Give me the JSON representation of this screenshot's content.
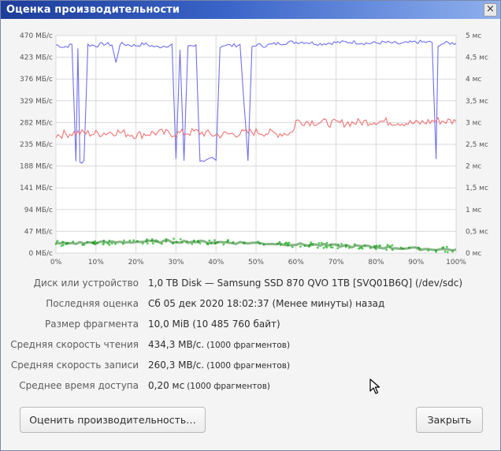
{
  "window": {
    "title": "Оценка производительности",
    "close_icon": "×"
  },
  "chart_data": {
    "type": "line",
    "x_ticks": [
      "0%",
      "10%",
      "20%",
      "30%",
      "40%",
      "50%",
      "60%",
      "70%",
      "80%",
      "90%",
      "100%"
    ],
    "y_left_ticks": [
      "0 МБ/с",
      "47 МБ/с",
      "94 МБ/с",
      "141 МБ/с",
      "188 МБ/с",
      "235 МБ/с",
      "282 МБ/с",
      "329 МБ/с",
      "376 МБ/с",
      "423 МБ/с",
      "470 МБ/с"
    ],
    "y_right_ticks": [
      "0 мс",
      "0,5 мс",
      "1 мс",
      "1,5 мс",
      "2 мс",
      "2,5 мс",
      "3 мс",
      "3,5 мс",
      "4 мс",
      "4,5 мс",
      "5 мс"
    ],
    "ylim_left": [
      0,
      470
    ],
    "ylim_right": [
      0,
      5
    ],
    "xlim": [
      0,
      100
    ],
    "grid": true,
    "colors": {
      "read": "#6f6ff0",
      "write": "#f07272",
      "access": "#22b822",
      "grid": "#d8d8d8"
    },
    "series": [
      {
        "key": "read",
        "axis": "left",
        "x": [
          0,
          2,
          4,
          5,
          5.5,
          6,
          7,
          8,
          10,
          12,
          14,
          15,
          16,
          18,
          20,
          22,
          25,
          29,
          30,
          31,
          32,
          33,
          34,
          35,
          36,
          37,
          38,
          39,
          40,
          41,
          42,
          44,
          46,
          48,
          49,
          50,
          52,
          55,
          58,
          62,
          66,
          70,
          74,
          78,
          82,
          86,
          90,
          94,
          95,
          95.5,
          96,
          98,
          100
        ],
        "y": [
          450,
          445,
          450,
          200,
          440,
          195,
          200,
          450,
          448,
          452,
          450,
          410,
          452,
          450,
          448,
          452,
          445,
          450,
          200,
          440,
          200,
          448,
          450,
          448,
          200,
          195,
          200,
          205,
          200,
          445,
          450,
          448,
          450,
          200,
          445,
          450,
          448,
          452,
          455,
          456,
          452,
          455,
          456,
          453,
          455,
          452,
          456,
          455,
          200,
          445,
          452,
          454,
          453
        ]
      },
      {
        "key": "write",
        "axis": "left",
        "x": [
          0,
          5,
          10,
          15,
          20,
          25,
          30,
          35,
          40,
          45,
          50,
          55,
          59,
          60,
          65,
          70,
          75,
          80,
          85,
          90,
          95,
          100
        ],
        "y": [
          255,
          260,
          258,
          262,
          255,
          260,
          258,
          262,
          255,
          258,
          262,
          258,
          260,
          285,
          283,
          280,
          282,
          285,
          283,
          280,
          286,
          284
        ]
      },
      {
        "key": "access",
        "axis": "right",
        "x": [
          0,
          10,
          20,
          30,
          40,
          50,
          60,
          70,
          80,
          90,
          100
        ],
        "y": [
          0.22,
          0.24,
          0.26,
          0.27,
          0.25,
          0.23,
          0.2,
          0.17,
          0.14,
          0.1,
          0.08
        ]
      }
    ]
  },
  "info": [
    {
      "label": "Диск или устройство",
      "value": "1,0 TB Disk — Samsung SSD 870 QVO 1TB [SVQ01B6Q] (/dev/sdc)",
      "note": ""
    },
    {
      "label": "Последняя оценка",
      "value": "Сб 05 дек 2020 18:02:37 (Менее минуты) назад",
      "note": ""
    },
    {
      "label": "Размер фрагмента",
      "value": "10,0 MiB (10 485 760 байт)",
      "note": ""
    },
    {
      "label": "Средняя скорость чтения",
      "value": "434,3 MB/с.",
      "note": "(1000 фрагментов)"
    },
    {
      "label": "Средняя скорость записи",
      "value": "260,3 MB/с.",
      "note": "(1000 фрагментов)"
    },
    {
      "label": "Среднее время доступа",
      "value": "0,20 мс",
      "note": "(1000 фрагментов)"
    }
  ],
  "buttons": {
    "benchmark_label": "Оценить производительность…",
    "close_label": "Закрыть"
  }
}
